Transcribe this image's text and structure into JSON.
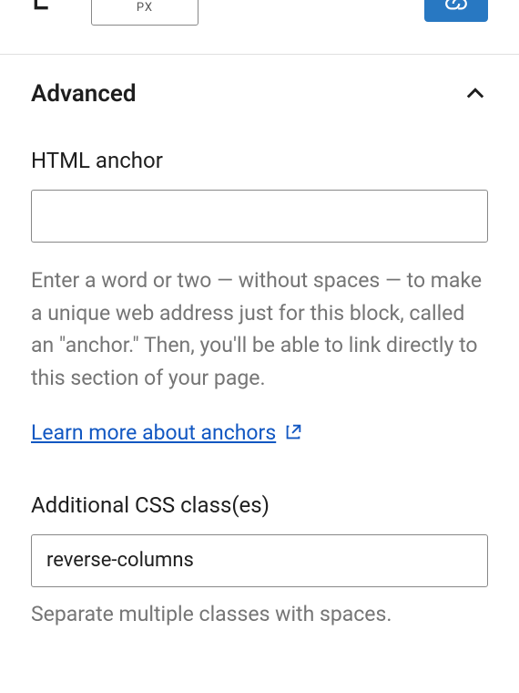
{
  "topBar": {
    "unitLabel": "PX"
  },
  "panel": {
    "title": "Advanced",
    "htmlAnchor": {
      "label": "HTML anchor",
      "value": "",
      "help": "Enter a word or two — without spaces — to make a unique web address just for this block, called an \"anchor.\" Then, you'll be able to link directly to this section of your page.",
      "linkText": "Learn more about anchors"
    },
    "cssClasses": {
      "label": "Additional CSS class(es)",
      "value": "reverse-columns",
      "help": "Separate multiple classes with spaces."
    }
  }
}
